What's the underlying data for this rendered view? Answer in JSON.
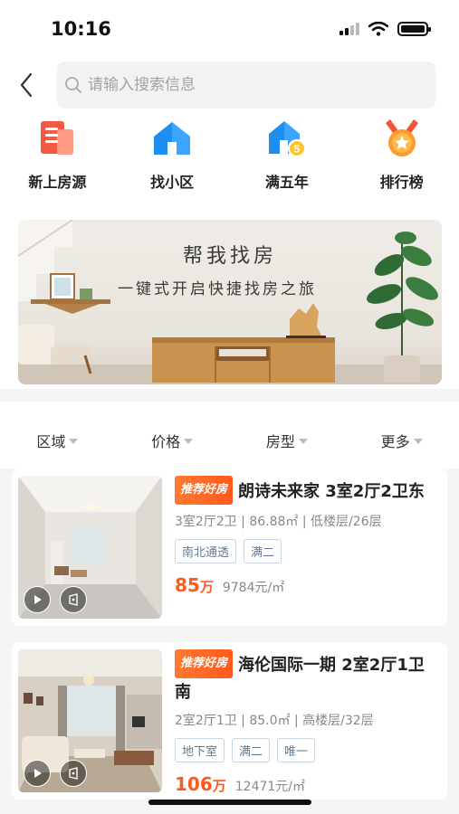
{
  "status_bar": {
    "time": "10:16"
  },
  "search": {
    "placeholder": "请输入搜索信息"
  },
  "quick_nav": [
    {
      "label": "新上房源",
      "icon": "document-list-icon",
      "color": "#f25a42"
    },
    {
      "label": "找小区",
      "icon": "house-icon",
      "color": "#1f8ef1"
    },
    {
      "label": "满五年",
      "icon": "house-badge-icon",
      "color": "#1f8ef1"
    },
    {
      "label": "排行榜",
      "icon": "medal-icon",
      "color": "#ff9a2e"
    }
  ],
  "banner": {
    "title": "帮我找房",
    "subtitle": "一键式开启快捷找房之旅"
  },
  "filters": [
    {
      "label": "区域"
    },
    {
      "label": "价格"
    },
    {
      "label": "房型"
    },
    {
      "label": "更多"
    }
  ],
  "listings": [
    {
      "badge": "推荐好房",
      "title": "朗诗未来家 3室2厅2卫东",
      "meta": "3室2厅2卫 | 86.88㎡ | 低楼层/26层",
      "tags": [
        "南北通透",
        "满二"
      ],
      "price": "85",
      "price_unit": "万",
      "unit_price": "9784元/㎡"
    },
    {
      "badge": "推荐好房",
      "title": "海伦国际一期 2室2厅1卫 南",
      "meta": "2室2厅1卫 | 85.0㎡ | 高楼层/32层",
      "tags": [
        "地下室",
        "满二",
        "唯一"
      ],
      "price": "106",
      "price_unit": "万",
      "unit_price": "12471元/㎡"
    }
  ],
  "colors": {
    "accent": "#ff5a1e",
    "chip_text": "#5e7c9a"
  }
}
